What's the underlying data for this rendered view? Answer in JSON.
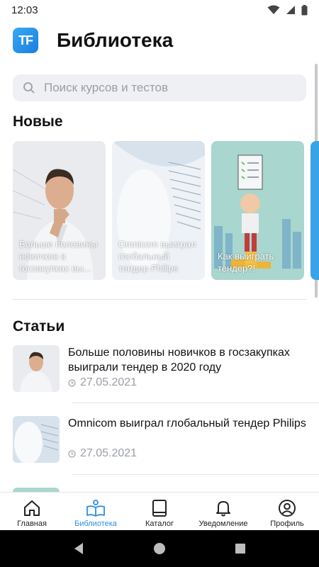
{
  "status_bar": {
    "time": "12:03"
  },
  "header": {
    "logo_text": "TF",
    "title": "Библиотека"
  },
  "search": {
    "placeholder": "Поиск курсов и тестов"
  },
  "new_section": {
    "title": "Новые",
    "cards": [
      {
        "label": "Больше половины новичков в госзакупках вы..."
      },
      {
        "label": "Omnicom выиграл глобальный тендер Philips"
      },
      {
        "label": "Как выиграть тендер?!"
      }
    ]
  },
  "articles_section": {
    "title": "Статьи",
    "items": [
      {
        "title": "Больше половины новичков в госзакупках выиграли тендер в 2020 году",
        "date": "27.05.2021"
      },
      {
        "title": "Omnicom выиграл глобальный тендер Philips",
        "date": "27.05.2021"
      }
    ]
  },
  "bottom_nav": {
    "items": [
      {
        "label": "Главная",
        "icon": "home-icon",
        "active": false
      },
      {
        "label": "Библиотека",
        "icon": "book-icon",
        "active": true
      },
      {
        "label": "Каталог",
        "icon": "catalog-icon",
        "active": false
      },
      {
        "label": "Уведомление",
        "icon": "bell-icon",
        "active": false
      },
      {
        "label": "Профиль",
        "icon": "profile-icon",
        "active": false
      }
    ]
  },
  "colors": {
    "accent": "#2f8fdc",
    "logo": "#2196f3",
    "muted": "#9a9ea5"
  }
}
